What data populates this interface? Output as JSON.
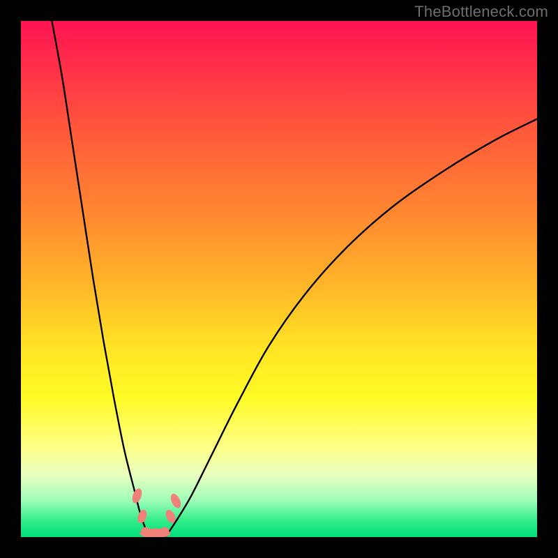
{
  "watermark": "TheBottleneck.com",
  "chart_data": {
    "type": "line",
    "title": "",
    "xlabel": "",
    "ylabel": "",
    "xlim": [
      0,
      100
    ],
    "ylim": [
      0,
      100
    ],
    "series": [
      {
        "name": "left-branch",
        "x": [
          6,
          8,
          10,
          12,
          14,
          16,
          18,
          20,
          22,
          23,
          24,
          25
        ],
        "y": [
          100,
          89,
          76,
          63,
          50,
          38,
          27,
          17,
          9,
          5,
          2,
          0
        ]
      },
      {
        "name": "right-branch",
        "x": [
          28,
          30,
          33,
          37,
          42,
          48,
          55,
          63,
          72,
          82,
          92,
          100
        ],
        "y": [
          0,
          3,
          8,
          16,
          26,
          37,
          47,
          56,
          64,
          71,
          77,
          81
        ]
      }
    ],
    "annotations": [
      {
        "name": "left-blob-upper",
        "x": 22.5,
        "y": 8
      },
      {
        "name": "left-blob-lower",
        "x": 23.5,
        "y": 4
      },
      {
        "name": "bottom-blob",
        "x": 26,
        "y": 1
      },
      {
        "name": "right-blob-lower",
        "x": 29,
        "y": 4
      },
      {
        "name": "right-blob-upper",
        "x": 30,
        "y": 7
      }
    ],
    "gradient_stops": [
      {
        "pos": 0.0,
        "color": "#ff1450"
      },
      {
        "pos": 0.22,
        "color": "#ff5b3a"
      },
      {
        "pos": 0.52,
        "color": "#ffb928"
      },
      {
        "pos": 0.73,
        "color": "#fffb26"
      },
      {
        "pos": 0.93,
        "color": "#9cfdb8"
      },
      {
        "pos": 1.0,
        "color": "#00e07a"
      }
    ]
  }
}
